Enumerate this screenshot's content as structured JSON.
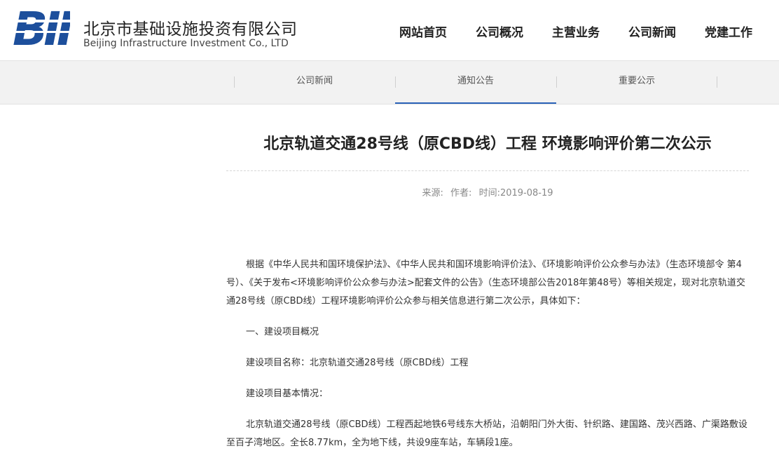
{
  "brand": {
    "name_cn": "北京市基础设施投资有限公司",
    "name_en": "Beijing Infrastructure Investment Co., LTD",
    "logo_text": "BII",
    "color": "#1d4f9c"
  },
  "nav": {
    "items": [
      "网站首页",
      "公司概况",
      "主营业务",
      "公司新闻",
      "党建工作"
    ]
  },
  "subnav": {
    "items": [
      "公司新闻",
      "通知公告",
      "重要公示"
    ],
    "active": "通知公告",
    "active_color": "#2a62b8"
  },
  "article": {
    "title": "北京轨道交通28号线（原CBD线）工程 环境影响评价第二次公示",
    "source_label": "来源:",
    "author_label": "作者:",
    "time_label": "时间:2019-08-19",
    "paragraphs": [
      "根据《中华人民共和国环境保护法》、《中华人民共和国环境影响评价法》、《环境影响评价公众参与办法》（生态环境部令 第4号）、《关于发布<环境影响评价公众参与办法>配套文件的公告》（生态环境部公告2018年第48号）等相关规定，现对北京轨道交通28号线（原CBD线）工程环境影响评价公众参与相关信息进行第二次公示，具体如下：",
      "一、建设项目概况",
      "建设项目名称：北京轨道交通28号线（原CBD线）工程",
      "建设项目基本情况：",
      "北京轨道交通28号线（原CBD线）工程西起地铁6号线东大桥站，沿朝阳门外大街、针织路、建国路、茂兴西路、广渠路敷设至百子湾地区。全长8.77km，全为地下线，共设9座车站，车辆段1座。"
    ]
  }
}
